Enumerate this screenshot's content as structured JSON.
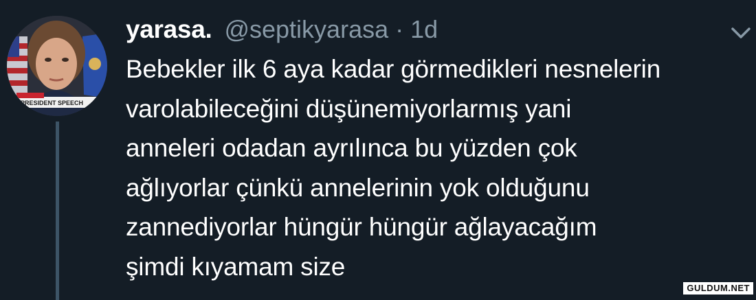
{
  "tweet": {
    "display_name": "yarasa.",
    "handle": "@septikyarasa",
    "separator": "·",
    "timestamp": "1d",
    "text_lines": [
      "Bebekler ilk 6 aya kadar görmedikleri nesnelerin",
      "varolabileceğini düşünemiyorlarmış yani",
      "anneleri odadan ayrılınca bu yüzden çok",
      "ağlıyorlar çünkü annelerinin yok olduğunu",
      "zannediyorlar hüngür hüngür ağlayacağım",
      "şimdi kıyamam size"
    ]
  },
  "avatar": {
    "banner_text": "PRESIDENT SPEECH"
  },
  "icons": {
    "menu": "chevron-down-icon"
  },
  "watermark": {
    "text": "GULDUM.NET"
  },
  "colors": {
    "background": "#141d26",
    "text": "#ffffff",
    "secondary_text": "#8899a6",
    "thread_line": "#3d5466"
  }
}
